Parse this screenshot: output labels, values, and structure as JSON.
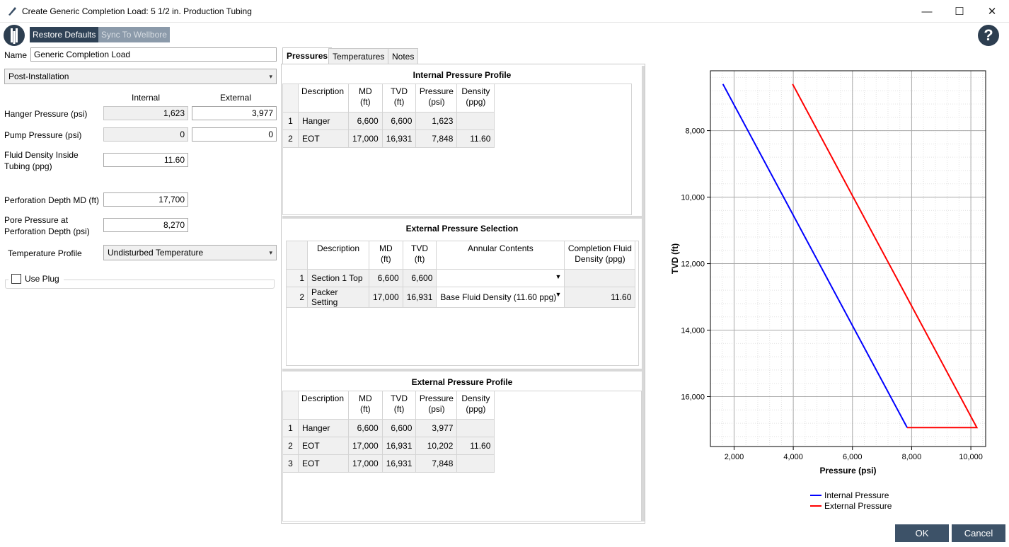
{
  "window": {
    "title": "Create Generic Completion Load: 5 1/2 in. Production Tubing",
    "minimize": "—",
    "maximize": "☐",
    "close": "✕"
  },
  "toolbar": {
    "restore_defaults": "Restore Defaults",
    "sync_to_wellbore": "Sync To Wellbore",
    "help": "?"
  },
  "form": {
    "name_label": "Name",
    "name_value": "Generic Completion Load",
    "phase": "Post-Installation",
    "col_internal": "Internal",
    "col_external": "External",
    "hanger_pressure_label": "Hanger Pressure (psi)",
    "hanger_internal": "1,623",
    "hanger_external": "3,977",
    "pump_pressure_label": "Pump Pressure (psi)",
    "pump_internal": "0",
    "pump_external": "0",
    "fluid_density_label_1": "Fluid Density Inside",
    "fluid_density_label_2": "Tubing (ppg)",
    "fluid_density_value": "11.60",
    "perf_depth_label": "Perforation Depth MD (ft)",
    "perf_depth_value": "17,700",
    "pore_pressure_label_1": "Pore Pressure at",
    "pore_pressure_label_2": "Perforation Depth (psi)",
    "pore_pressure_value": "8,270",
    "temp_profile_label": "Temperature Profile",
    "temp_profile_value": "Undisturbed Temperature",
    "use_plug_label": "Use Plug"
  },
  "tabs": [
    "Pressures",
    "Temperatures",
    "Notes"
  ],
  "internal_profile": {
    "title": "Internal Pressure Profile",
    "headers": [
      "Description",
      "MD\n(ft)",
      "TVD\n(ft)",
      "Pressure\n(psi)",
      "Density\n(ppg)"
    ],
    "rows": [
      {
        "n": "1",
        "desc": "Hanger",
        "md": "6,600",
        "tvd": "6,600",
        "pressure": "1,623",
        "density": ""
      },
      {
        "n": "2",
        "desc": "EOT",
        "md": "17,000",
        "tvd": "16,931",
        "pressure": "7,848",
        "density": "11.60"
      }
    ]
  },
  "external_selection": {
    "title": "External Pressure Selection",
    "headers": [
      "Description",
      "MD\n(ft)",
      "TVD\n(ft)",
      "Annular Contents",
      "Completion Fluid\nDensity (ppg)"
    ],
    "rows": [
      {
        "n": "1",
        "desc": "Section 1 Top",
        "md": "6,600",
        "tvd": "6,600",
        "contents": "",
        "density": ""
      },
      {
        "n": "2",
        "desc": "Packer Setting",
        "md": "17,000",
        "tvd": "16,931",
        "contents": "Base Fluid Density (11.60 ppg)",
        "density": "11.60"
      }
    ]
  },
  "external_profile": {
    "title": "External Pressure Profile",
    "headers": [
      "Description",
      "MD\n(ft)",
      "TVD\n(ft)",
      "Pressure\n(psi)",
      "Density\n(ppg)"
    ],
    "rows": [
      {
        "n": "1",
        "desc": "Hanger",
        "md": "6,600",
        "tvd": "6,600",
        "pressure": "3,977",
        "density": ""
      },
      {
        "n": "2",
        "desc": "EOT",
        "md": "17,000",
        "tvd": "16,931",
        "pressure": "10,202",
        "density": "11.60"
      },
      {
        "n": "3",
        "desc": "EOT",
        "md": "17,000",
        "tvd": "16,931",
        "pressure": "7,848",
        "density": ""
      }
    ]
  },
  "buttons": {
    "ok": "OK",
    "cancel": "Cancel"
  },
  "colors": {
    "internal": "#0000ff",
    "external": "#ff0000",
    "button": "#3d5268"
  },
  "chart_data": {
    "type": "line",
    "xlabel": "Pressure (psi)",
    "ylabel": "TVD (ft)",
    "xlim": [
      1200,
      10500
    ],
    "ylim": [
      6200,
      17500
    ],
    "y_inverted": true,
    "xticks": [
      2000,
      4000,
      6000,
      8000,
      10000
    ],
    "xtick_labels": [
      "2,000",
      "4,000",
      "6,000",
      "8,000",
      "10,000"
    ],
    "yticks": [
      8000,
      10000,
      12000,
      14000,
      16000
    ],
    "ytick_labels": [
      "8,000",
      "10,000",
      "12,000",
      "14,000",
      "16,000"
    ],
    "grid": true,
    "legend_position": "bottom-center",
    "series": [
      {
        "name": "Internal Pressure",
        "color": "#0000ff",
        "x": [
          1623,
          7848
        ],
        "y": [
          6600,
          16931
        ]
      },
      {
        "name": "External Pressure",
        "color": "#ff0000",
        "x": [
          3977,
          10202,
          7848
        ],
        "y": [
          6600,
          16931,
          16931
        ]
      }
    ]
  }
}
